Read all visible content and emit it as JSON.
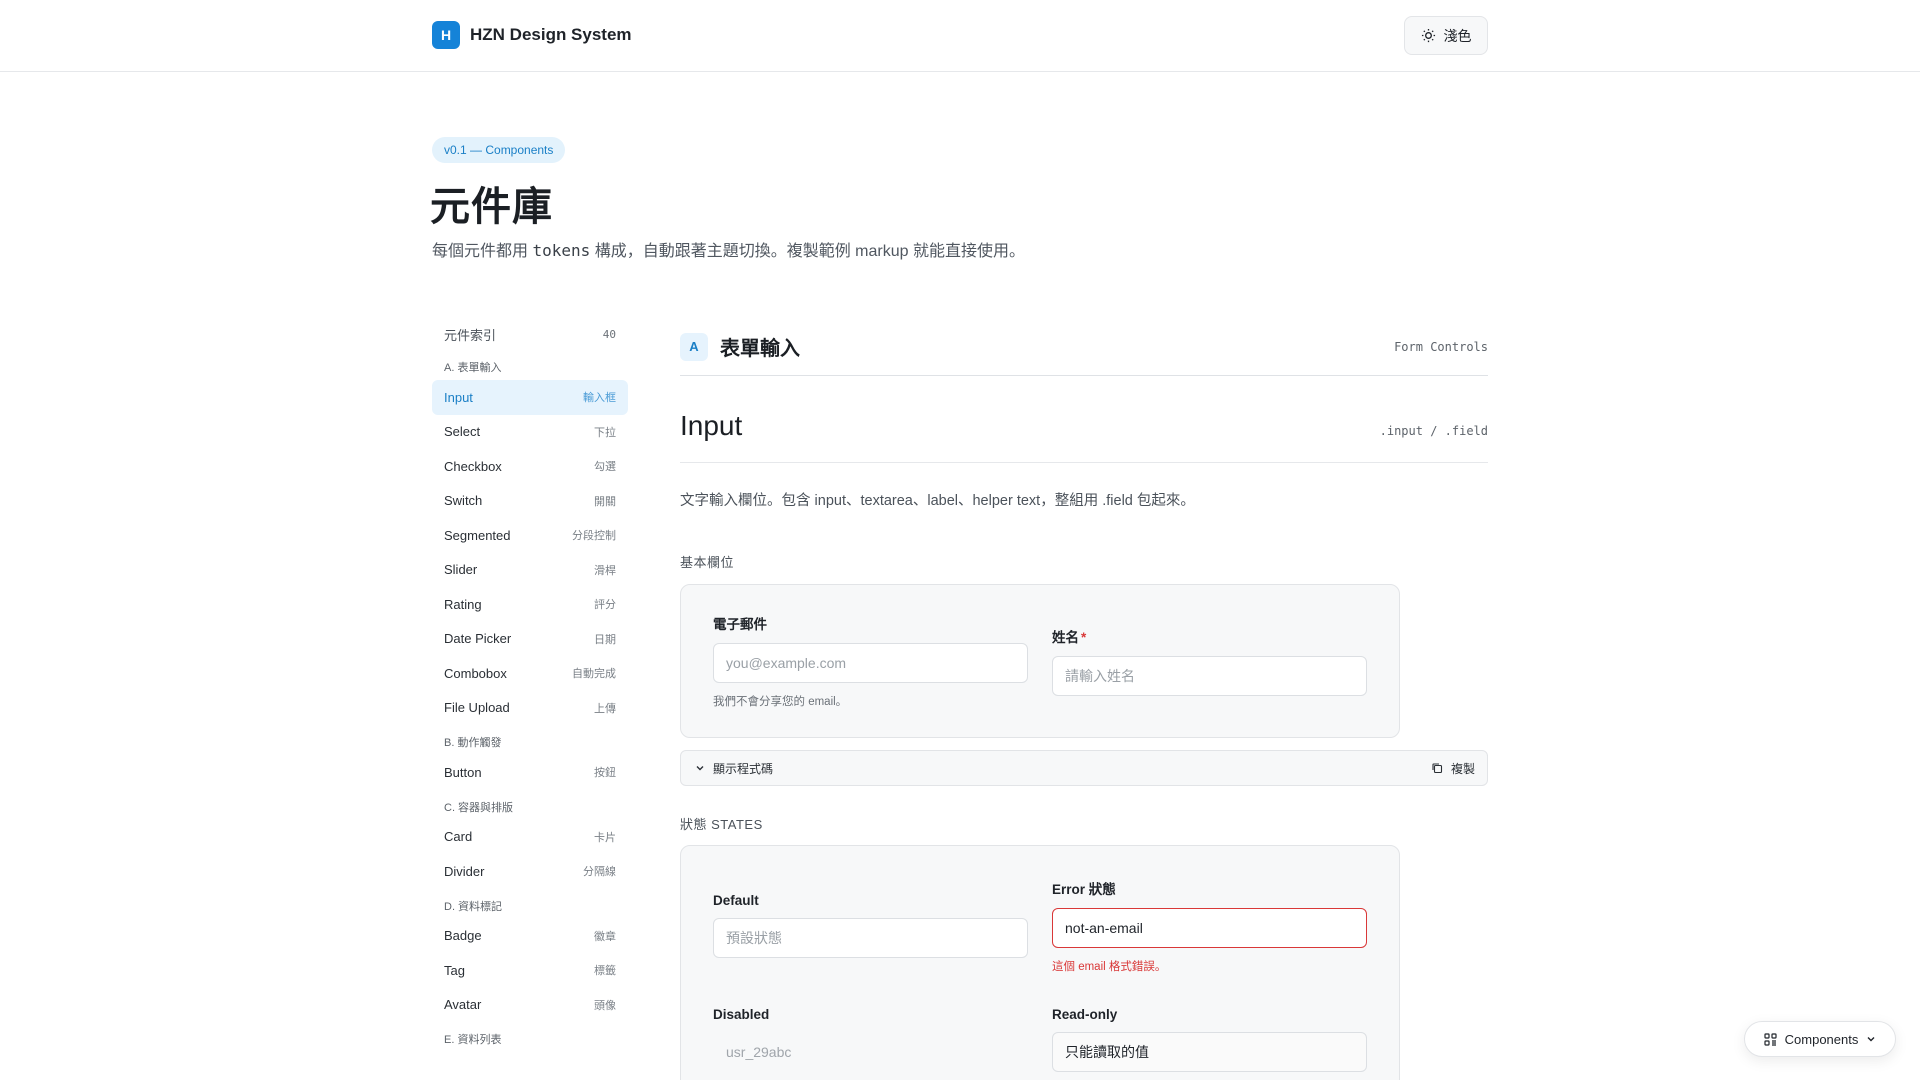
{
  "header": {
    "logo_letter": "H",
    "brand_name": "HZN Design System",
    "theme_label": "淺色"
  },
  "hero": {
    "version": "v0.1 — Components",
    "title": "元件庫",
    "subtitle_pre": "每個元件都用 ",
    "subtitle_code": "tokens",
    "subtitle_post": " 構成，自動跟著主題切換。複製範例 markup 就能直接使用。"
  },
  "sidebar": {
    "index_label": "元件索引",
    "index_count": "40",
    "groups": [
      {
        "label": "A. 表單輸入",
        "items": [
          {
            "label": "Input",
            "zh": "輸入框"
          },
          {
            "label": "Select",
            "zh": "下拉"
          },
          {
            "label": "Checkbox",
            "zh": "勾選"
          },
          {
            "label": "Switch",
            "zh": "開關"
          },
          {
            "label": "Segmented",
            "zh": "分段控制"
          },
          {
            "label": "Slider",
            "zh": "滑桿"
          },
          {
            "label": "Rating",
            "zh": "評分"
          },
          {
            "label": "Date Picker",
            "zh": "日期"
          },
          {
            "label": "Combobox",
            "zh": "自動完成"
          },
          {
            "label": "File Upload",
            "zh": "上傳"
          }
        ]
      },
      {
        "label": "B. 動作觸發",
        "items": [
          {
            "label": "Button",
            "zh": "按鈕"
          }
        ]
      },
      {
        "label": "C. 容器與排版",
        "items": [
          {
            "label": "Card",
            "zh": "卡片"
          },
          {
            "label": "Divider",
            "zh": "分隔線"
          }
        ]
      },
      {
        "label": "D. 資料標記",
        "items": [
          {
            "label": "Badge",
            "zh": "徽章"
          },
          {
            "label": "Tag",
            "zh": "標籤"
          },
          {
            "label": "Avatar",
            "zh": "頭像"
          }
        ]
      },
      {
        "label": "E. 資料列表",
        "items": []
      }
    ]
  },
  "section": {
    "badge": "A",
    "title": "表單輸入",
    "en": "Form Controls"
  },
  "component": {
    "title": "Input",
    "class_names": ".input / .field",
    "description": "文字輸入欄位。包含 input、textarea、label、helper text，整組用 .field 包起來。"
  },
  "basic": {
    "label": "基本欄位",
    "email_label": "電子郵件",
    "email_placeholder": "you@example.com",
    "email_helper": "我們不會分享您的 email。",
    "name_label": "姓名",
    "name_required": "*",
    "name_placeholder": "請輸入姓名"
  },
  "code_bar": {
    "toggle": "顯示程式碼",
    "copy": "複製"
  },
  "states": {
    "label": "狀態 STATES",
    "default_label": "Default",
    "default_placeholder": "預設狀態",
    "error_label": "Error 狀態",
    "error_value": "not-an-email",
    "error_helper": "這個 email 格式錯誤。",
    "disabled_label": "Disabled",
    "disabled_value": "usr_29abc",
    "readonly_label": "Read-only",
    "readonly_value": "只能讀取的值"
  },
  "floating": {
    "label": "Components"
  }
}
